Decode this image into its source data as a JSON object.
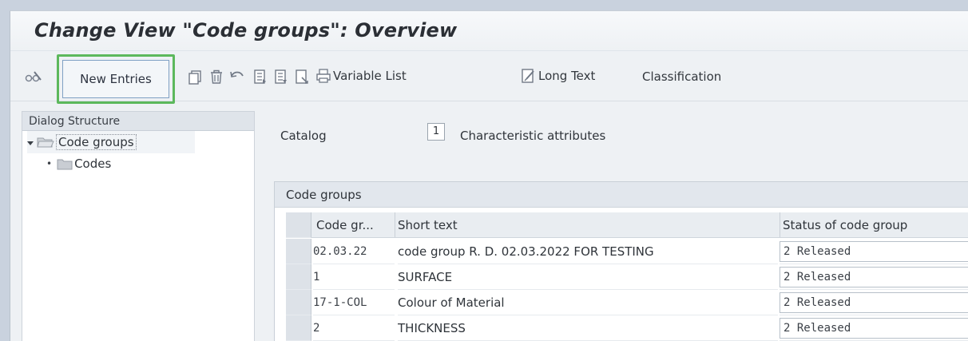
{
  "window": {
    "title": "Change View \"Code groups\": Overview"
  },
  "toolbar": {
    "new_entries": "New Entries",
    "variable_list": "Variable List",
    "long_text": "Long Text",
    "classification": "Classification",
    "icons": [
      "glasses-display-change-icon",
      "copy-icon",
      "delete-icon",
      "undo-icon",
      "previous-entry-icon",
      "next-entry-icon",
      "other-entry-icon",
      "print-icon",
      "long-text-icon"
    ]
  },
  "dialog_structure": {
    "header": "Dialog Structure",
    "items": [
      {
        "label": "Code groups",
        "level": 1,
        "selected": true,
        "expanded": true
      },
      {
        "label": "Codes",
        "level": 2,
        "selected": false
      }
    ]
  },
  "catalog": {
    "label": "Catalog",
    "value": "1",
    "description": "Characteristic attributes"
  },
  "code_groups_table": {
    "title": "Code groups",
    "columns": [
      "Code gr...",
      "Short text",
      "Status of code group"
    ],
    "rows": [
      {
        "code": "02.03.22",
        "short_text": "code group R. D. 02.03.2022 FOR TESTING",
        "status": "2 Released"
      },
      {
        "code": "1",
        "short_text": "SURFACE",
        "status": "2 Released"
      },
      {
        "code": "17-1-COL",
        "short_text": "Colour of Material",
        "status": "2 Released"
      },
      {
        "code": "2",
        "short_text": "THICKNESS",
        "status": "2 Released"
      }
    ]
  },
  "colors": {
    "highlight": "#5cb85c",
    "background": "#eef1f4"
  }
}
